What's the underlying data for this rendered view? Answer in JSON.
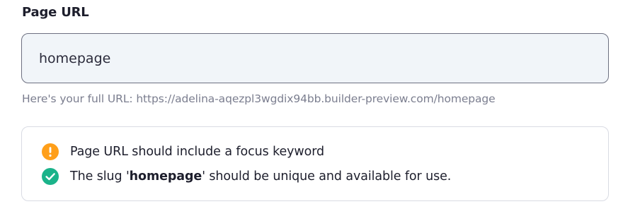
{
  "field": {
    "label": "Page URL",
    "value": "homepage"
  },
  "helper": {
    "text": "Here's your full URL: https://adelina-aqezpl3wgdix94bb.builder-preview.com/homepage"
  },
  "checks": [
    {
      "status": "warning",
      "icon": "warning-icon",
      "color": "#ff9f1a",
      "text": "Page URL should include a focus keyword"
    },
    {
      "status": "success",
      "icon": "check-circle-icon",
      "color": "#1bb38a",
      "text_before": "The slug '",
      "text_bold": "homepage",
      "text_after": "' should be unique and available for use."
    }
  ],
  "colors": {
    "input_bg": "#f1f5f9",
    "input_border": "#6d7081",
    "helper_text": "#7b7e8f"
  }
}
